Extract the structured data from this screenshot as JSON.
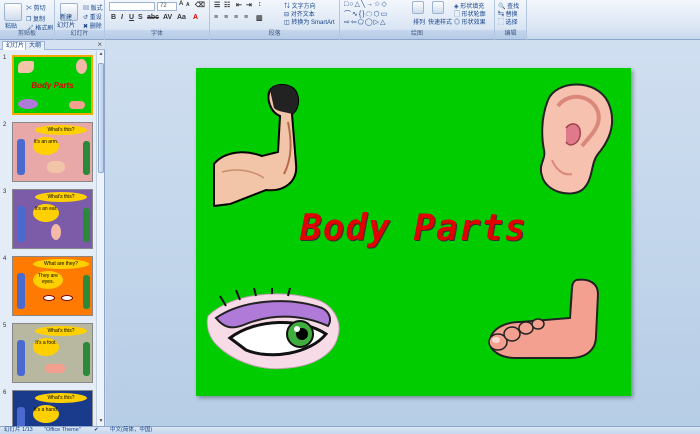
{
  "ribbon": {
    "groups": [
      {
        "label": "剪贴板"
      },
      {
        "label": "幻灯片"
      },
      {
        "label": "字体"
      },
      {
        "label": "段落"
      },
      {
        "label": "绘图"
      },
      {
        "label": "编辑"
      }
    ],
    "clipboard": {
      "paste": "粘贴",
      "cut": "剪切",
      "copy": "复制",
      "format_painter": "格式刷"
    },
    "slides": {
      "new_slide": "新建",
      "new_slide_sub": "幻灯片",
      "layout": "版式",
      "reset": "重设",
      "delete": "删除"
    },
    "font": {
      "font_name": "",
      "font_size": "72"
    },
    "paragraph": {
      "text_direction": "文字方向",
      "align_text": "对齐文本",
      "smartart": "转换为 SmartArt"
    },
    "drawing": {
      "arrange": "排列",
      "quick_styles": "快速样式",
      "shape_fill": "形状填充",
      "shape_outline": "形状轮廓",
      "shape_effects": "形状效果"
    },
    "editing": {
      "find": "查找",
      "replace": "替换",
      "select": "选择"
    }
  },
  "left_panel": {
    "tabs": [
      {
        "label": "幻灯片"
      },
      {
        "label": "大纲"
      }
    ],
    "thumbnails": [
      {
        "num": "1",
        "title": "Body Parts",
        "bg": "#00cc00",
        "selected": true
      },
      {
        "num": "2",
        "q": "What's this?",
        "a": "It's an arm.",
        "bg": "#e8a8a8"
      },
      {
        "num": "3",
        "q": "What's this?",
        "a": "It's an ear.",
        "bg": "#7c5ca8"
      },
      {
        "num": "4",
        "q": "What are they?",
        "a": "They are eyes.",
        "bg": "#ff7a00"
      },
      {
        "num": "5",
        "q": "What's this?",
        "a": "It's a foot.",
        "bg": "#b8b8a0"
      },
      {
        "num": "6",
        "q": "What's this?",
        "a": "It's a hand.",
        "bg": "#1a3a8c"
      }
    ]
  },
  "slide": {
    "title": "Body Parts"
  },
  "status_bar": {
    "slide_info": "幻灯片 1/13",
    "theme": "\"Office Theme\"",
    "language": "中文(简体，中国)"
  }
}
